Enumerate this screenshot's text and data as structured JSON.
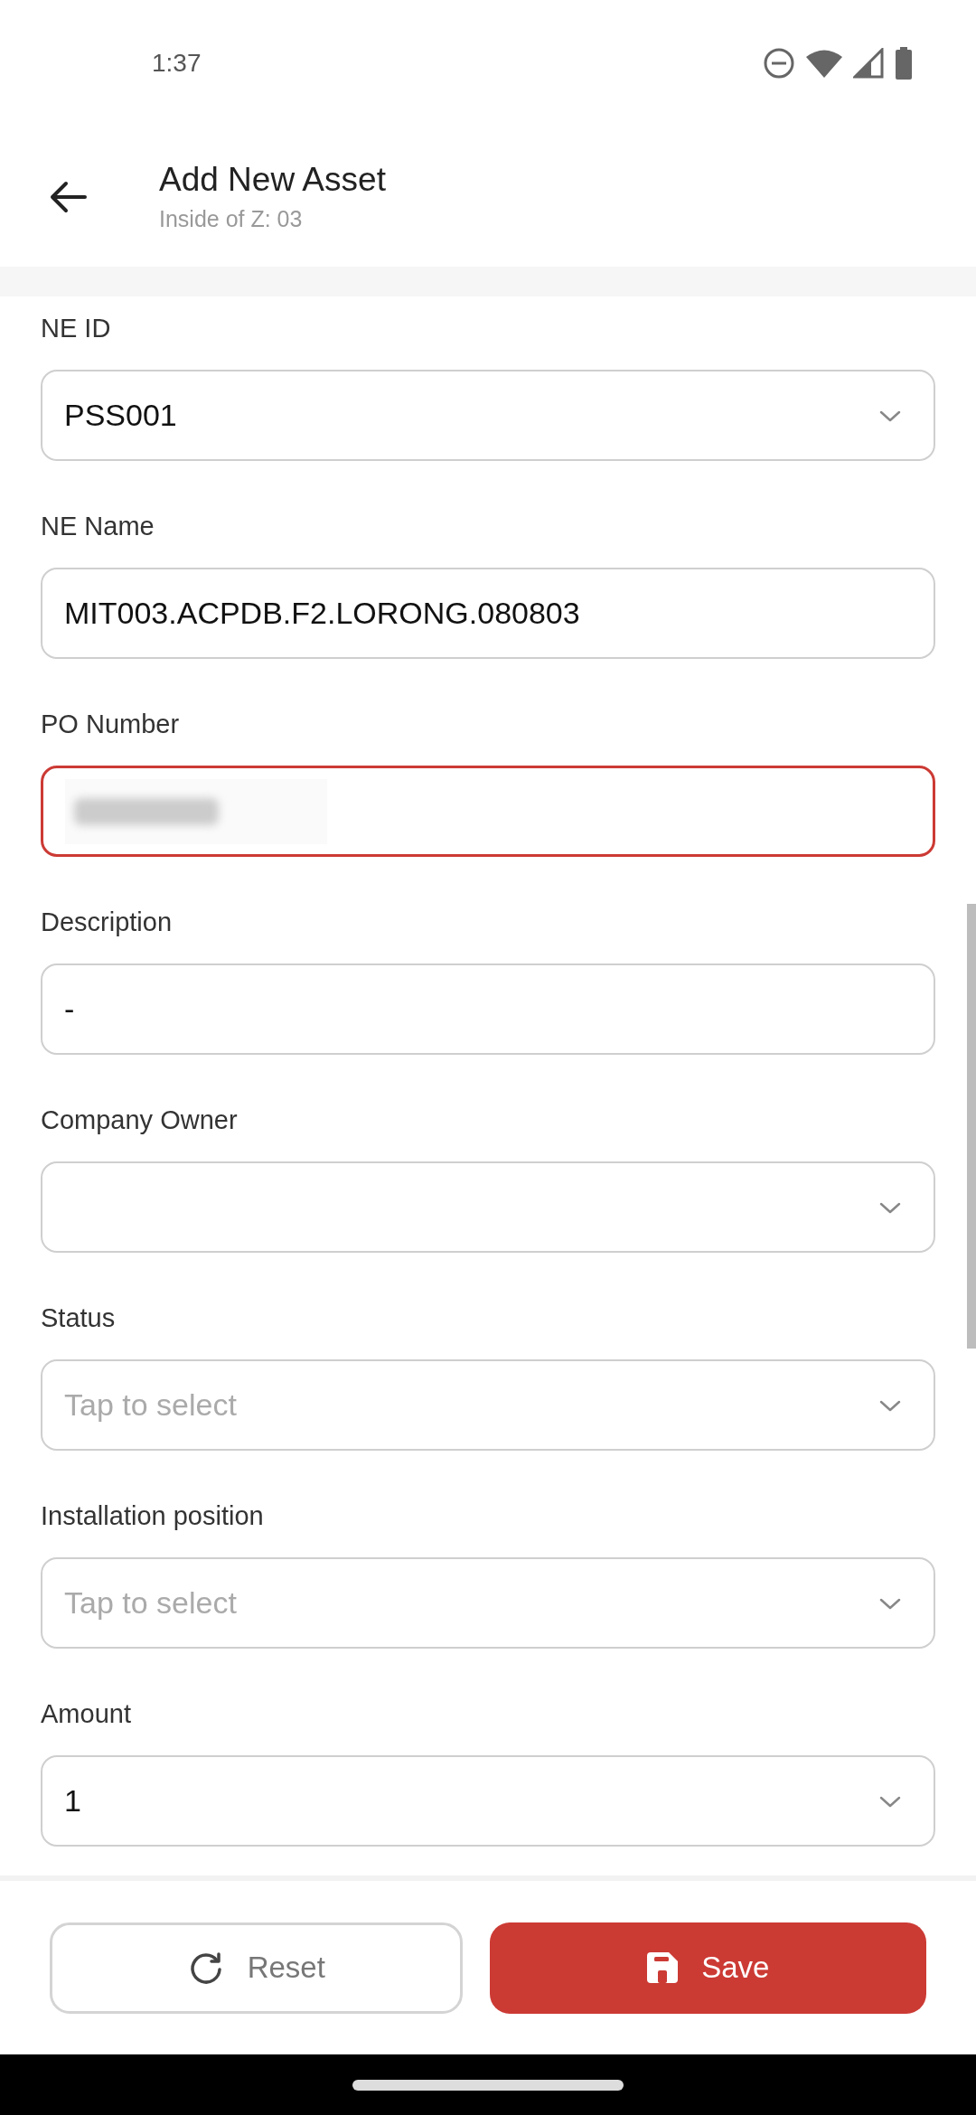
{
  "status_bar": {
    "time": "1:37"
  },
  "header": {
    "title": "Add New Asset",
    "subtitle": "Inside of Z: 03"
  },
  "fields": [
    {
      "label": "NE ID",
      "kind": "select",
      "value": "PSS001",
      "error": false
    },
    {
      "label": "NE Name",
      "kind": "text",
      "value": "MIT003.ACPDB.F2.LORONG.080803",
      "error": false
    },
    {
      "label": "PO Number",
      "kind": "redacted",
      "error": true
    },
    {
      "label": "Description",
      "kind": "text",
      "value": "-",
      "error": false
    },
    {
      "label": "Company Owner",
      "kind": "select",
      "error": false
    },
    {
      "label": "Status",
      "kind": "select",
      "placeholder": "Tap to select",
      "error": false
    },
    {
      "label": "Installation position",
      "kind": "select",
      "placeholder": "Tap to select",
      "error": false
    },
    {
      "label": "Amount",
      "kind": "select",
      "value": "1",
      "error": false
    }
  ],
  "buttons": [
    {
      "kind": "reset",
      "label": "Reset"
    },
    {
      "kind": "save",
      "label": "Save"
    }
  ]
}
